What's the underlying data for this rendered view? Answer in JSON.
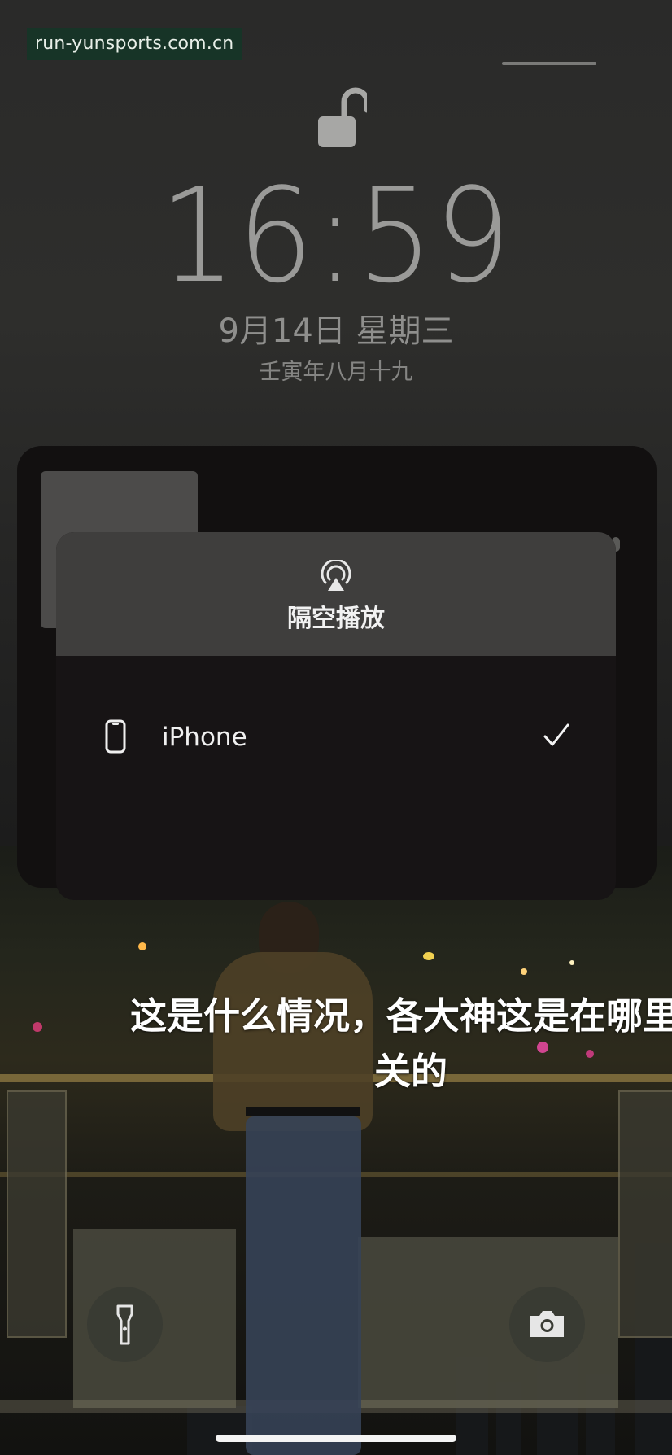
{
  "watermark": {
    "text": "run-yunsports.com.cn"
  },
  "lock_screen": {
    "time": "16:59",
    "date": "9月14日 星期三",
    "lunar_date": "壬寅年八月十九"
  },
  "airplay_sheet": {
    "title": "隔空播放",
    "devices": [
      {
        "name": "iPhone",
        "selected": true
      }
    ]
  },
  "subtitle": {
    "line1": "这是什么情况，各大神这是在哪里",
    "line2": "关的"
  },
  "icons": {
    "lock": "unlocked-padlock-icon",
    "airplay": "airplay-icon",
    "device": "iphone-icon",
    "check": "checkmark-icon",
    "flashlight": "flashlight-icon",
    "camera": "camera-icon"
  },
  "colors": {
    "watermark_bg": "#173427",
    "sheet_header": "#3f3e3d",
    "sheet_body": "#171415"
  }
}
